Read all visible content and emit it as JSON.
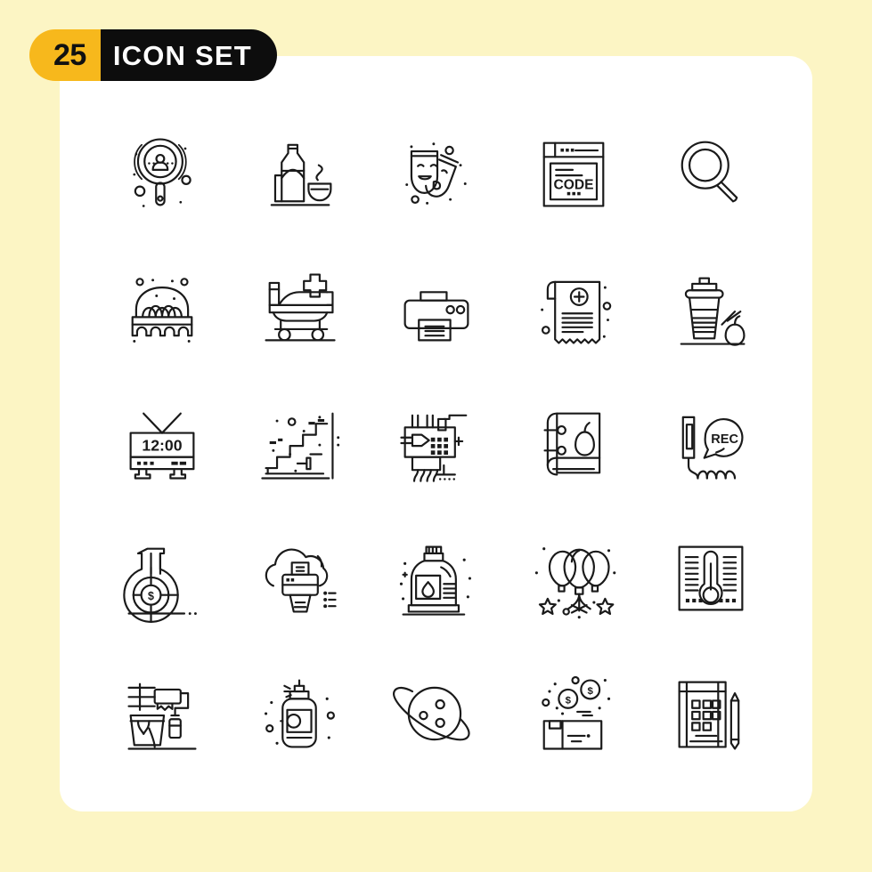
{
  "page": {
    "background_color": "#fcf5c4",
    "card_color": "#ffffff"
  },
  "badge": {
    "count": "25",
    "title": "ICON SET",
    "count_bg": "#f7b81c",
    "title_bg": "#0d0d0d",
    "count_text_color": "#111111",
    "title_text_color": "#ffffff"
  },
  "grid": {
    "columns": 5,
    "rows": 5,
    "stroke_color": "#1a1a1a",
    "icons": [
      {
        "index": 1,
        "name": "user-search-icon",
        "label": "magnifier with person"
      },
      {
        "index": 2,
        "name": "bottle-bowl-icon",
        "label": "bottle and bowl"
      },
      {
        "index": 3,
        "name": "theater-masks-icon",
        "label": "theatre masks"
      },
      {
        "index": 4,
        "name": "code-browser-icon",
        "label": "browser window code",
        "text": "CODE"
      },
      {
        "index": 5,
        "name": "search-icon",
        "label": "magnifying glass"
      },
      {
        "index": 6,
        "name": "egg-carton-icon",
        "label": "eggs in basket"
      },
      {
        "index": 7,
        "name": "hospital-bed-icon",
        "label": "hospital bed"
      },
      {
        "index": 8,
        "name": "printer-icon",
        "label": "printer"
      },
      {
        "index": 9,
        "name": "medical-receipt-icon",
        "label": "prescription receipt"
      },
      {
        "index": 10,
        "name": "coffee-apple-icon",
        "label": "coffee cup and apple"
      },
      {
        "index": 11,
        "name": "digital-clock-tv-icon",
        "label": "retro tv clock",
        "text": "12:00"
      },
      {
        "index": 12,
        "name": "stairs-icon",
        "label": "stairs"
      },
      {
        "index": 13,
        "name": "circuit-chip-icon",
        "label": "circuit board chip"
      },
      {
        "index": 14,
        "name": "book-apple-icon",
        "label": "notebook with apple"
      },
      {
        "index": 15,
        "name": "call-recording-icon",
        "label": "phone with rec bubble",
        "text": "REC"
      },
      {
        "index": 16,
        "name": "funding-flask-icon",
        "label": "flask with dollar"
      },
      {
        "index": 17,
        "name": "cloud-printer-icon",
        "label": "cloud printing"
      },
      {
        "index": 18,
        "name": "detergent-bottle-icon",
        "label": "detergent bottle"
      },
      {
        "index": 19,
        "name": "balloons-icon",
        "label": "balloons with stars"
      },
      {
        "index": 20,
        "name": "thermometer-icon",
        "label": "framed thermometer"
      },
      {
        "index": 21,
        "name": "paint-roller-icon",
        "label": "paint roller and bucket"
      },
      {
        "index": 22,
        "name": "spray-can-icon",
        "label": "spray can"
      },
      {
        "index": 23,
        "name": "planet-icon",
        "label": "planet with ring"
      },
      {
        "index": 24,
        "name": "package-funding-icon",
        "label": "box with coins"
      },
      {
        "index": 25,
        "name": "notepad-pencil-icon",
        "label": "notepad with pencil"
      }
    ]
  }
}
